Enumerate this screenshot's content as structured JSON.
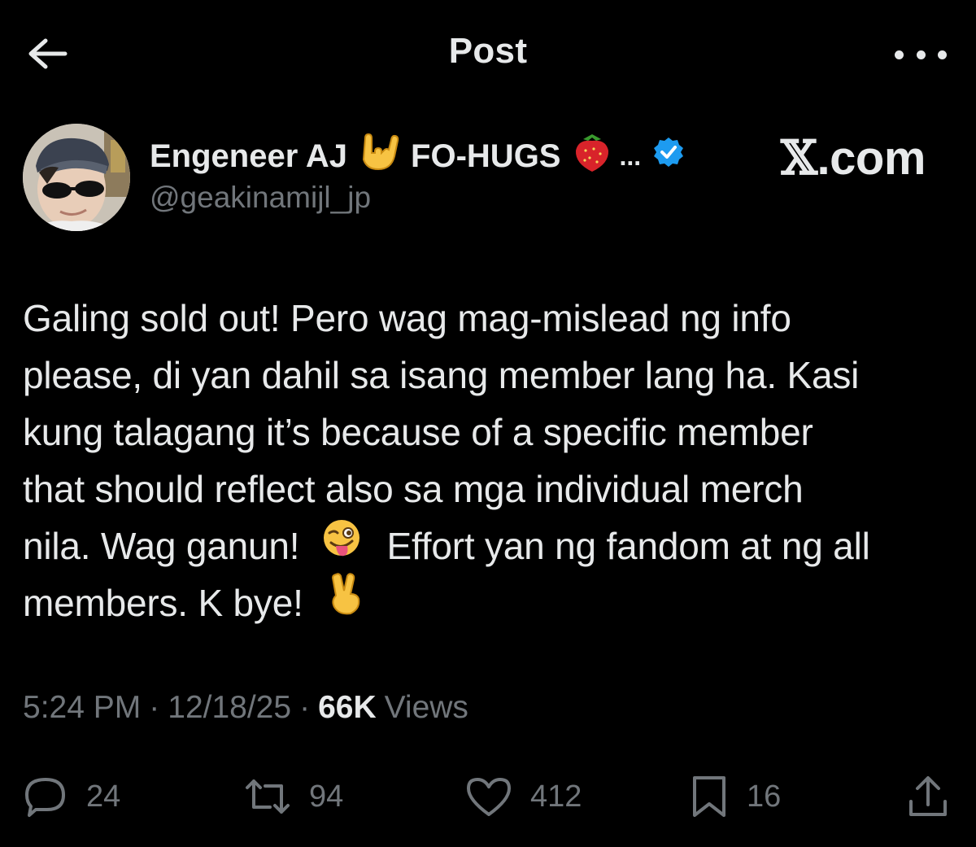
{
  "header": {
    "title": "Post",
    "back_icon": "arrow-left-icon",
    "more_icon": "more-horizontal-icon"
  },
  "author": {
    "display_name_part1": "Engeneer AJ",
    "display_name_part2": "FO-HUGS",
    "display_name_ellipsis": "...",
    "emoji_1": "love-you-hand-sign",
    "emoji_2": "strawberry",
    "verified": "verified-badge-icon",
    "handle": "@geakinamijl_jp"
  },
  "watermark": {
    "x": "𝕏",
    "text": ".com"
  },
  "post": {
    "lines": [
      "Galing sold out! Pero wag mag-mislead ng info",
      "please, di yan dahil sa isang member lang ha. Kasi",
      "kung talagang it’s because of a specific member",
      "that should reflect also sa mga individual merch",
      "nila. Wag ganun!",
      "Effort yan ng fandom at ng all",
      "members. K bye!"
    ],
    "emoji_wink_tongue": "😜",
    "emoji_victory": "✌️"
  },
  "meta": {
    "time": "5:24 PM",
    "dot": "·",
    "date": "12/18/25",
    "views_count": "66K",
    "views_label": "Views"
  },
  "actions": {
    "replies": "24",
    "reposts": "94",
    "likes": "412",
    "bookmarks": "16"
  },
  "colors": {
    "background": "#000000",
    "text": "#e7e9ea",
    "secondary": "#71767b",
    "verified": "#1d9bf0"
  }
}
